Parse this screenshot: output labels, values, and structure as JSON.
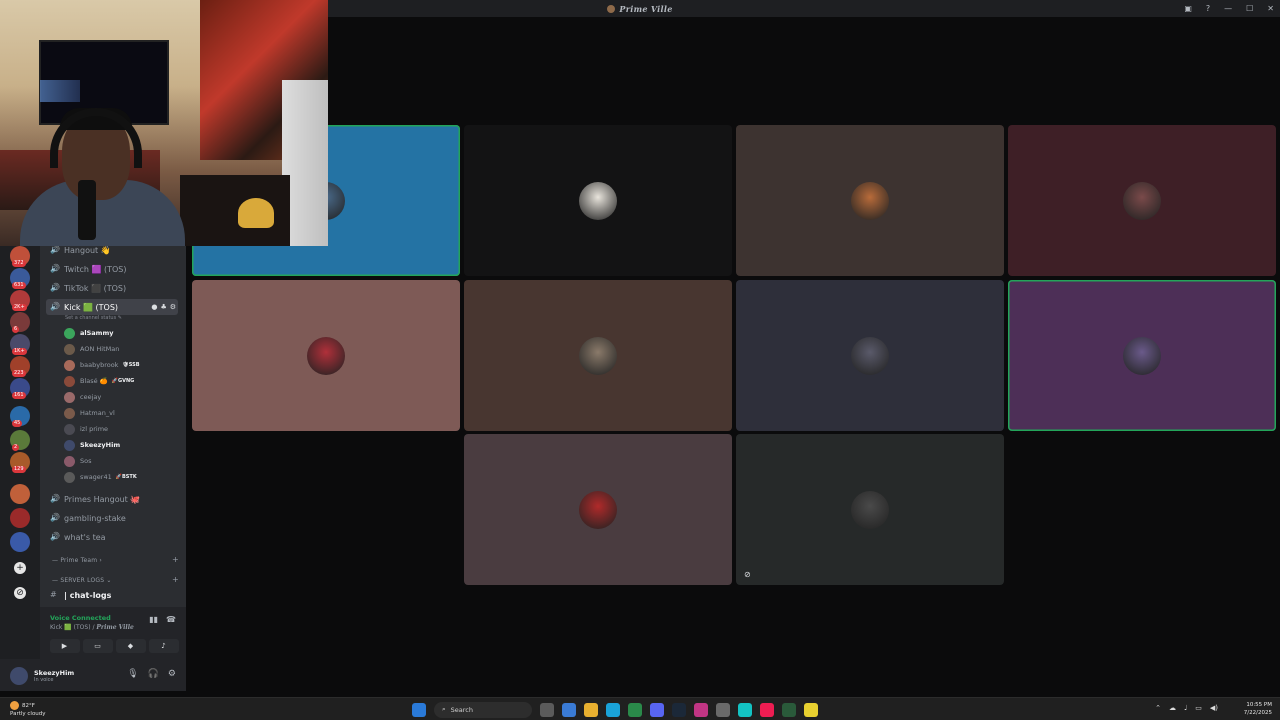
{
  "window": {
    "title": "Prime Ville"
  },
  "sidebar": {
    "channels_top": [
      {
        "name": "Hangout 👋"
      },
      {
        "name": "Twitch 🟪 (TOS)"
      },
      {
        "name": "TikTok ⬛ (TOS)"
      }
    ],
    "active_channel": {
      "name": "Kick 🟩 (TOS)",
      "status": "Set a channel status ✎"
    },
    "members": [
      {
        "name": "alSammy",
        "tag": "",
        "bold": true,
        "color": "#3ba55c"
      },
      {
        "name": "AON HitMan",
        "tag": "",
        "bold": false,
        "color": "#6b5a4a"
      },
      {
        "name": "baabybrook",
        "tag": "🛡SSB",
        "bold": false,
        "color": "#a86a5a"
      },
      {
        "name": "Blasé 🍊",
        "tag": "🚀GVNG",
        "bold": false,
        "color": "#8a4a3a"
      },
      {
        "name": "ceejay",
        "tag": "",
        "bold": false,
        "color": "#9a6a6a"
      },
      {
        "name": "Hatman_vl",
        "tag": "",
        "bold": false,
        "color": "#7a5a4a"
      },
      {
        "name": "izl prime",
        "tag": "",
        "bold": false,
        "color": "#4a4a52"
      },
      {
        "name": "SkeezyHim",
        "tag": "",
        "bold": true,
        "color": "#3f4a6b"
      },
      {
        "name": "Sos",
        "tag": "",
        "bold": false,
        "color": "#8a5a6a"
      },
      {
        "name": "swager41",
        "tag": "🚀BSTK",
        "bold": false,
        "color": "#5a5a5a"
      }
    ],
    "channels_bottom": [
      {
        "name": "Primes Hangout 🐙"
      },
      {
        "name": "gambling-stake"
      },
      {
        "name": "what's tea"
      }
    ],
    "categories": [
      {
        "name": "Prime Team ›"
      },
      {
        "name": "SERVER LOGS ⌄"
      }
    ],
    "text_channel": {
      "name": "| chat-logs"
    }
  },
  "rail": {
    "badges": [
      "372",
      "631",
      "2K+",
      "6",
      "1K+",
      "223",
      "161",
      "45",
      "2",
      "129"
    ]
  },
  "voice_panel": {
    "title": "Voice Connected",
    "channel": "Kick 🟩 (TOS) /",
    "server": "Prime Ville"
  },
  "user_panel": {
    "name": "SkeezyHim",
    "status": "In voice"
  },
  "participants": [
    {
      "bg": "#2473a4",
      "avatar": "#4a6a8a",
      "speaking": true,
      "muted": false
    },
    {
      "bg": "#131314",
      "avatar": "#e8e4dc",
      "speaking": false,
      "muted": false
    },
    {
      "bg": "#3d3330",
      "avatar": "#b86b3a",
      "speaking": false,
      "muted": false
    },
    {
      "bg": "#3e1f26",
      "avatar": "#7a4a4a",
      "speaking": false,
      "muted": false
    },
    {
      "bg": "#7e5a56",
      "avatar": "#b0303a",
      "speaking": false,
      "muted": false
    },
    {
      "bg": "#483630",
      "avatar": "#8a7a6a",
      "speaking": false,
      "muted": false
    },
    {
      "bg": "#2e2f3a",
      "avatar": "#5a5a6a",
      "speaking": false,
      "muted": false
    },
    {
      "bg": "#4d2f57",
      "avatar": "#6a5a8a",
      "speaking": true,
      "muted": false
    },
    {
      "bg": "#4a3c40",
      "avatar": "#b02a2a",
      "speaking": false,
      "muted": false
    },
    {
      "bg": "#262929",
      "avatar": "#4a4a4a",
      "speaking": false,
      "muted": true
    }
  ],
  "taskbar": {
    "weather_temp": "82°F",
    "weather_desc": "Partly cloudy",
    "search_label": "Search",
    "time": "10:55 PM",
    "date": "7/22/2025",
    "app_colors": [
      "#5b5b5b",
      "#3a7bd5",
      "#e8b030",
      "#1aa3d9",
      "#2a8a4a",
      "#5865f2",
      "#1b2838",
      "#c13584",
      "#6a6a6a",
      "#13c2c2",
      "#ee1d52",
      "#2a5a3a",
      "#e8d030"
    ]
  }
}
